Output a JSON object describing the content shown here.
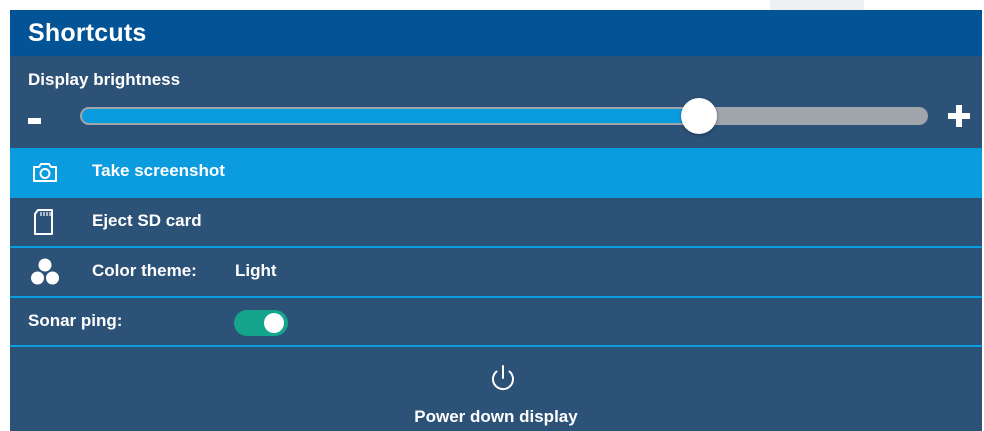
{
  "header": {
    "title": "Shortcuts"
  },
  "brightness": {
    "label": "Display brightness",
    "minus_label": "-",
    "plus_label": "+",
    "level_percent": 73
  },
  "menu": {
    "screenshot": {
      "label": "Take screenshot",
      "icon": "camera-icon"
    },
    "eject": {
      "label": "Eject SD card",
      "icon": "sd-card-icon"
    },
    "theme": {
      "label": "Color theme:",
      "value": "Light",
      "icon": "color-theme-icon"
    }
  },
  "sonar": {
    "label": "Sonar ping:",
    "enabled": true
  },
  "power": {
    "label": "Power down display",
    "icon": "power-icon"
  },
  "colors": {
    "title_bar": "#035497",
    "panel": "#2c5278",
    "accent": "#0b9bdf",
    "toggle_on": "#14a58c"
  }
}
